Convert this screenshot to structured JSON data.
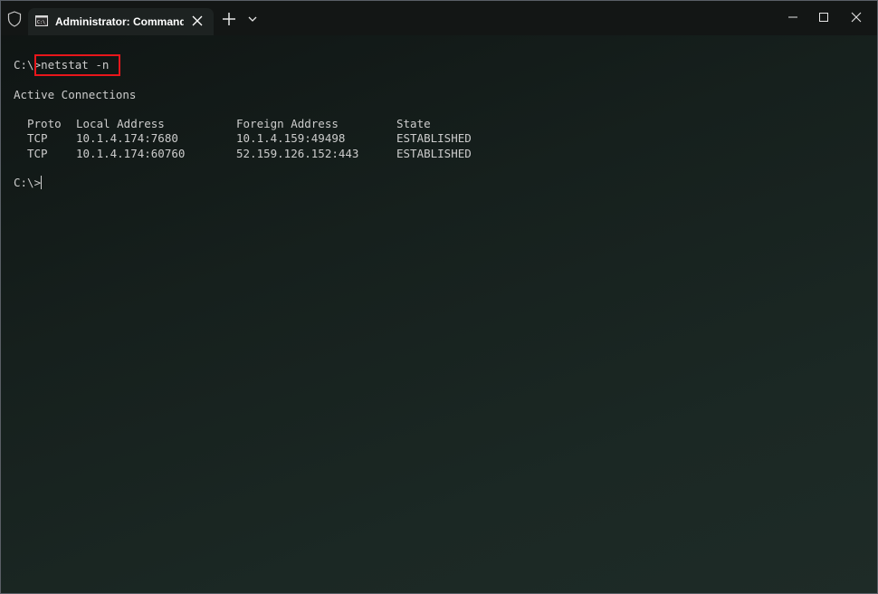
{
  "tab": {
    "title": "Administrator: Command Prompt",
    "icon": "cmd-icon"
  },
  "terminal": {
    "prompt": "C:\\>",
    "command": "netstat -n",
    "heading": "Active Connections",
    "columns": [
      "Proto",
      "Local Address",
      "Foreign Address",
      "State"
    ],
    "rows": [
      {
        "proto": "TCP",
        "local": "10.1.4.174:7680",
        "foreign": "10.1.4.159:49498",
        "state": "ESTABLISHED"
      },
      {
        "proto": "TCP",
        "local": "10.1.4.174:60760",
        "foreign": "52.159.126.152:443",
        "state": "ESTABLISHED"
      }
    ],
    "final_prompt": "C:\\>"
  },
  "colors": {
    "titlebar": "#131615",
    "active_tab": "#1d2221",
    "terminal_text": "#cccccc",
    "highlight_box": "#e8161b"
  }
}
